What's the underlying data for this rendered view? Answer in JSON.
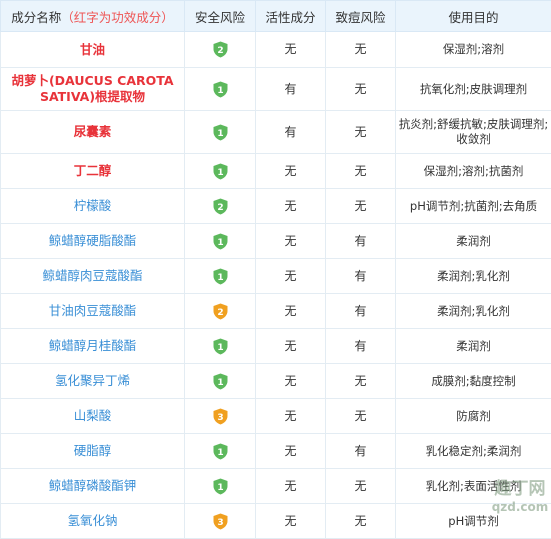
{
  "headers": {
    "name": "成分名称",
    "name_hint": "（红字为功效成分）",
    "safety": "安全风险",
    "active": "活性成分",
    "acne": "致痘风险",
    "purpose": "使用目的"
  },
  "colors": {
    "green": "#5cb85c",
    "orange": "#f0a020",
    "red_text": "#e8333a",
    "blue_text": "#3a8fd6"
  },
  "rows": [
    {
      "name": "甘油",
      "style": "red",
      "safety": "2",
      "safety_color": "green",
      "active": "无",
      "acne": "无",
      "purpose": "保湿剂;溶剂"
    },
    {
      "name": "胡萝卜(DAUCUS CAROTA SATIVA)根提取物",
      "style": "red",
      "safety": "1",
      "safety_color": "green",
      "active": "有",
      "acne": "无",
      "purpose": "抗氧化剂;皮肤调理剂"
    },
    {
      "name": "尿囊素",
      "style": "red",
      "safety": "1",
      "safety_color": "green",
      "active": "有",
      "acne": "无",
      "purpose": "抗炎剂;舒缓抗敏;皮肤调理剂;收敛剂"
    },
    {
      "name": "丁二醇",
      "style": "red",
      "safety": "1",
      "safety_color": "green",
      "active": "无",
      "acne": "无",
      "purpose": "保湿剂;溶剂;抗菌剂"
    },
    {
      "name": "柠檬酸",
      "style": "blue",
      "safety": "2",
      "safety_color": "green",
      "active": "无",
      "acne": "无",
      "purpose": "pH调节剂;抗菌剂;去角质"
    },
    {
      "name": "鲸蜡醇硬脂酸酯",
      "style": "blue",
      "safety": "1",
      "safety_color": "green",
      "active": "无",
      "acne": "有",
      "purpose": "柔润剂"
    },
    {
      "name": "鲸蜡醇肉豆蔻酸酯",
      "style": "blue",
      "safety": "1",
      "safety_color": "green",
      "active": "无",
      "acne": "有",
      "purpose": "柔润剂;乳化剂"
    },
    {
      "name": "甘油肉豆蔻酸酯",
      "style": "blue",
      "safety": "2",
      "safety_color": "orange",
      "active": "无",
      "acne": "有",
      "purpose": "柔润剂;乳化剂"
    },
    {
      "name": "鲸蜡醇月桂酸酯",
      "style": "blue",
      "safety": "1",
      "safety_color": "green",
      "active": "无",
      "acne": "有",
      "purpose": "柔润剂"
    },
    {
      "name": "氢化聚异丁烯",
      "style": "blue",
      "safety": "1",
      "safety_color": "green",
      "active": "无",
      "acne": "无",
      "purpose": "成膜剂;黏度控制"
    },
    {
      "name": "山梨酸",
      "style": "blue",
      "safety": "3",
      "safety_color": "orange",
      "active": "无",
      "acne": "无",
      "purpose": "防腐剂"
    },
    {
      "name": "硬脂醇",
      "style": "blue",
      "safety": "1",
      "safety_color": "green",
      "active": "无",
      "acne": "有",
      "purpose": "乳化稳定剂;柔润剂"
    },
    {
      "name": "鲸蜡醇磷酸酯钾",
      "style": "blue",
      "safety": "1",
      "safety_color": "green",
      "active": "无",
      "acne": "无",
      "purpose": "乳化剂;表面活性剂"
    },
    {
      "name": "氢氧化钠",
      "style": "blue",
      "safety": "3",
      "safety_color": "orange",
      "active": "无",
      "acne": "无",
      "purpose": "pH调节剂"
    }
  ],
  "watermark": {
    "line1": "趣丁网",
    "line2": "qzd.com"
  }
}
